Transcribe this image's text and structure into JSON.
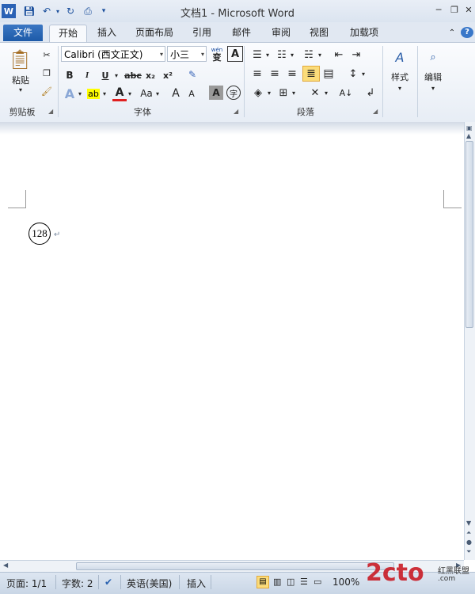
{
  "window": {
    "title": "文档1 - Microsoft Word"
  },
  "tabs": [
    "文件",
    "开始",
    "插入",
    "页面布局",
    "引用",
    "邮件",
    "审阅",
    "视图",
    "加载项"
  ],
  "clipboard": {
    "paste": "粘贴",
    "label": "剪贴板"
  },
  "font": {
    "name": "Calibri (西文正文)",
    "size": "小三",
    "label": "字体",
    "bold": "B",
    "italic": "I",
    "underline": "U",
    "strike": "abc",
    "sub": "x₂",
    "sup": "x²",
    "grow": "A",
    "shrink": "A",
    "case": "Aa",
    "color_a": "A",
    "shade_a": "A",
    "char_border": "A",
    "phonetic": "wén",
    "phonetic_char": "变",
    "enclose": "字"
  },
  "paragraph": {
    "label": "段落"
  },
  "styles": {
    "label": "样式"
  },
  "editing": {
    "label": "编辑"
  },
  "document": {
    "circled_text": "128",
    "para_mark": "↵"
  },
  "status": {
    "page": "页面: 1/1",
    "words": "字数: 2",
    "language": "英语(美国)",
    "mode": "插入",
    "zoom": "100%"
  },
  "watermark": {
    "logo": "2cto",
    "suffix": ".com",
    "site": "红黑联盟"
  }
}
